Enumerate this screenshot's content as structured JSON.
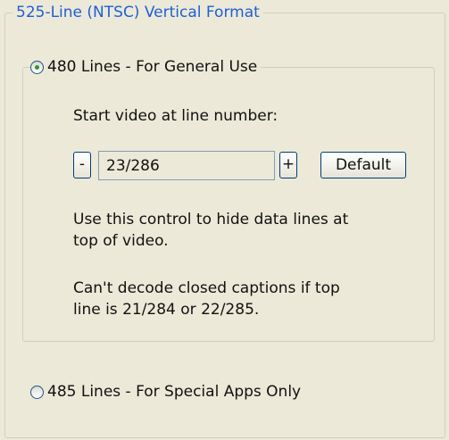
{
  "group": {
    "title": "525-Line (NTSC) Vertical Format"
  },
  "option_480": {
    "label": "480 Lines - For General Use",
    "selected": true
  },
  "start_line": {
    "label": "Start video at line number:",
    "value": "23/286",
    "decrement": "-",
    "increment": "+",
    "default_label": "Default"
  },
  "hints": {
    "hide_lines": "Use this control to hide data lines at top of video.",
    "captions": "Can't decode closed captions if top line is 21/284 or 22/285."
  },
  "option_485": {
    "label": "485 Lines - For Special Apps Only",
    "selected": false
  }
}
